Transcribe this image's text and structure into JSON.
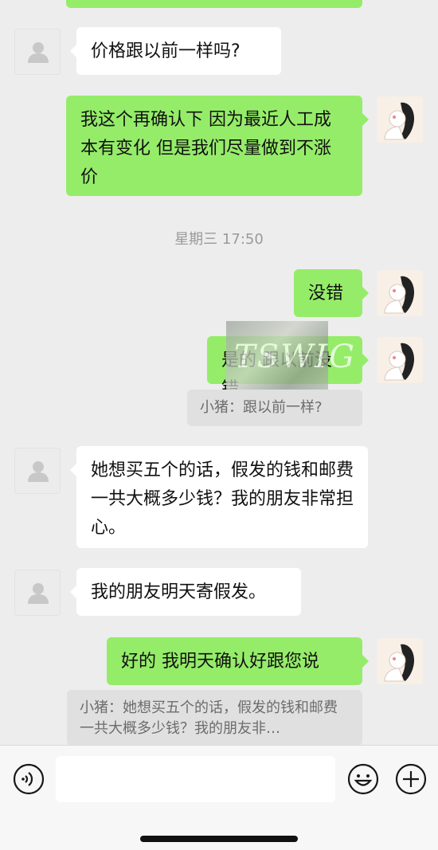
{
  "messages": [
    {
      "side": "left",
      "text": "价格跟以前一样吗?"
    },
    {
      "side": "right",
      "text": "我这个再确认下 因为最近人工成本有变化 但是我们尽量做到不涨价"
    },
    {
      "side": "right",
      "text": "没错"
    },
    {
      "side": "right",
      "text": "是的 跟以前没错"
    },
    {
      "side": "left",
      "text": "她想买五个的话，假发的钱和邮费一共大概多少钱？我的朋友非常担心。"
    },
    {
      "side": "left",
      "text": "我的朋友明天寄假发。"
    },
    {
      "side": "right",
      "text": "好的 我明天确认好跟您说"
    }
  ],
  "timestamp": "星期三 17:50",
  "quotes": [
    "小猪：跟以前一样?",
    "小猪：她想买五个的话，假发的钱和邮费一共大概多少钱？我的朋友非…"
  ],
  "watermark": "TSWIG",
  "colors": {
    "sent_bubble": "#95ec69",
    "received_bubble": "#ffffff",
    "background": "#ededed"
  },
  "icons": {
    "voice": "voice-icon",
    "emoji": "emoji-icon",
    "plus": "plus-icon"
  }
}
